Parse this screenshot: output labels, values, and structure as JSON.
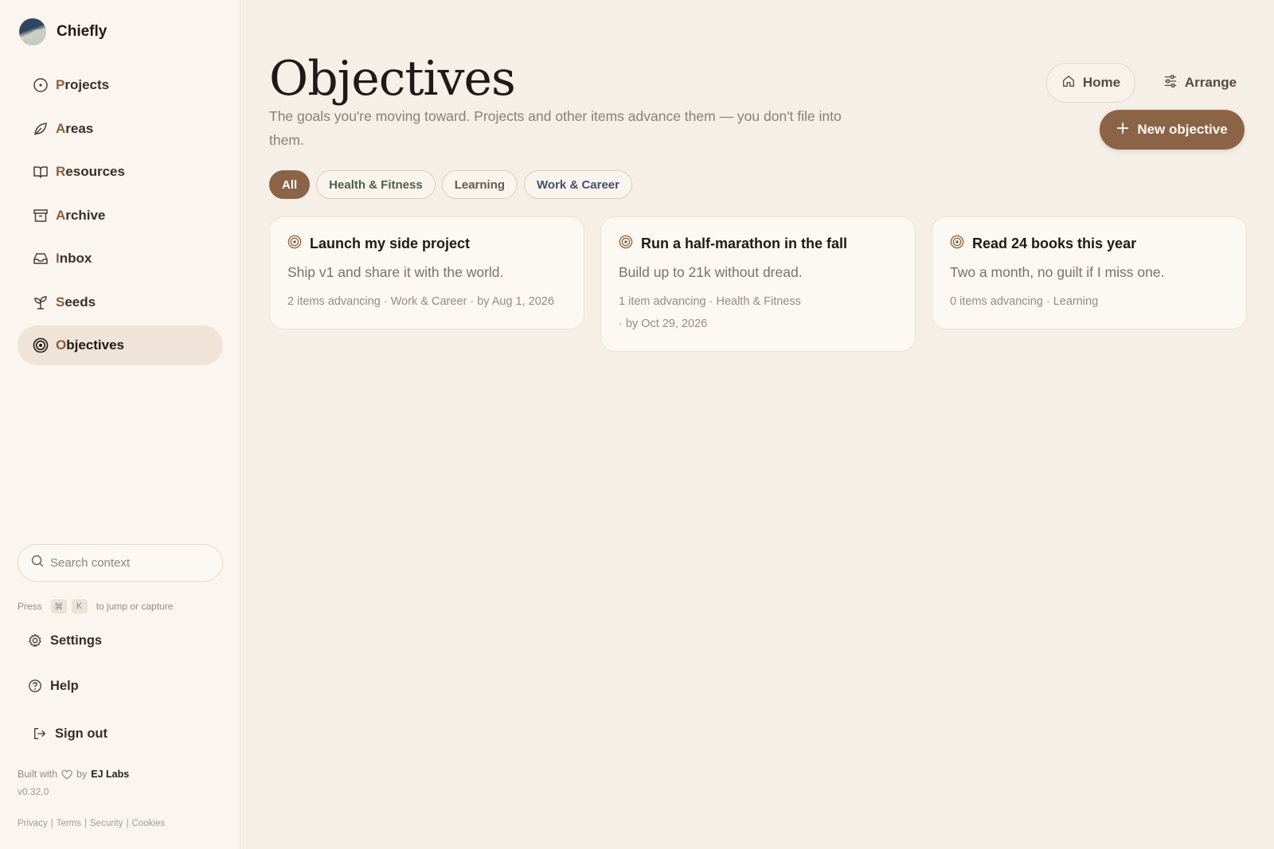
{
  "brand": {
    "name": "Chiefly"
  },
  "nav": [
    {
      "id": "projects",
      "label": "Projects",
      "icon": "circle-dot-icon"
    },
    {
      "id": "areas",
      "label": "Areas",
      "icon": "leaf-icon"
    },
    {
      "id": "resources",
      "label": "Resources",
      "icon": "book-icon"
    },
    {
      "id": "archive",
      "label": "Archive",
      "icon": "archive-box-icon"
    },
    {
      "id": "inbox",
      "label": "Inbox",
      "icon": "inbox-tray-icon"
    },
    {
      "id": "seeds",
      "label": "Seeds",
      "icon": "sprout-icon"
    },
    {
      "id": "objectives",
      "label": "Objectives",
      "icon": "target-icon",
      "active": true
    }
  ],
  "search": {
    "placeholder": "Search context"
  },
  "hint": {
    "prefix": "Press",
    "key1": "⌘",
    "key2": "K",
    "suffix": "to jump or capture"
  },
  "bottom_nav": {
    "settings": "Settings",
    "help": "Help",
    "sign_out": "Sign out"
  },
  "footer": {
    "built_with": "Built with",
    "by": "by",
    "company": "EJ Labs",
    "version": "v0.32.0",
    "links": [
      "Privacy",
      "Terms",
      "Security",
      "Cookies"
    ]
  },
  "page": {
    "title": "Objectives",
    "subtitle": "The goals you're moving toward. Projects and other items advance them — you don't file into them."
  },
  "actions": {
    "home": "Home",
    "arrange": "Arrange",
    "new_objective": "New objective"
  },
  "filters": [
    {
      "label": "All",
      "active": true
    },
    {
      "label": "Health & Fitness"
    },
    {
      "label": "Learning"
    },
    {
      "label": "Work & Career"
    }
  ],
  "objectives": [
    {
      "title": "Launch my side project",
      "description": "Ship v1 and share it with the world.",
      "items": "2 items advancing",
      "area": "Work & Career",
      "due": "by Aug 1, 2026"
    },
    {
      "title": "Run a half-marathon in the fall",
      "description": "Build up to 21k without dread.",
      "items": "1 item advancing",
      "area": "Health & Fitness",
      "due": "by Oct 29, 2026"
    },
    {
      "title": "Read 24 books this year",
      "description": "Two a month, no guilt if I miss one.",
      "items": "0 items advancing",
      "area": "Learning"
    }
  ],
  "colors": {
    "accent": "#8b6447",
    "sidebar_bg": "#faf5ef",
    "page_bg": "#f5efe7",
    "card_bg": "#fcf8f2"
  }
}
